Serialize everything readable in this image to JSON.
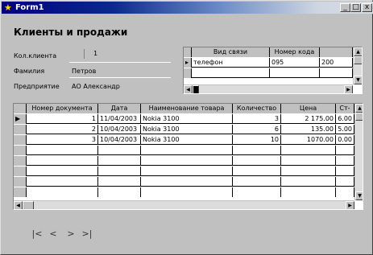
{
  "window": {
    "title": "Form1",
    "controls": {
      "minimize": "_",
      "maximize": "□",
      "close": "x"
    }
  },
  "heading": "Клиенты и продажи",
  "fields": {
    "doc_count_label": "Кол.клиента",
    "doc_count_value": "1",
    "surname_label": "Фамилия",
    "surname_value": "Петров",
    "company_label": "Предприятие",
    "company_value": "АО Александр"
  },
  "contacts_grid": {
    "columns": [
      "Вид связи",
      "Номер кода",
      ""
    ],
    "rows": [
      {
        "type": "телефон",
        "code": "095",
        "number": "200"
      }
    ]
  },
  "sales_grid": {
    "columns": [
      "Номер документа",
      "Дата",
      "Наименование товара",
      "Количество",
      "Цена",
      "Ст-"
    ],
    "rows": [
      {
        "doc": "1",
        "date": "11/04/2003",
        "product": "Nokia 3100",
        "qty": "3",
        "price": "2 175.00",
        "sum": "6.00"
      },
      {
        "doc": "2",
        "date": "10/04/2003",
        "product": "Nokia 3100",
        "qty": "6",
        "price": "135.00",
        "sum": "5.00"
      },
      {
        "doc": "3",
        "date": "10/04/2003",
        "product": "Nokia 3100",
        "qty": "10",
        "price": "1070.00",
        "sum": "0.00"
      }
    ]
  },
  "navigator": {
    "first": "|<",
    "prev": "<",
    "next": ">",
    "last": ">|"
  }
}
